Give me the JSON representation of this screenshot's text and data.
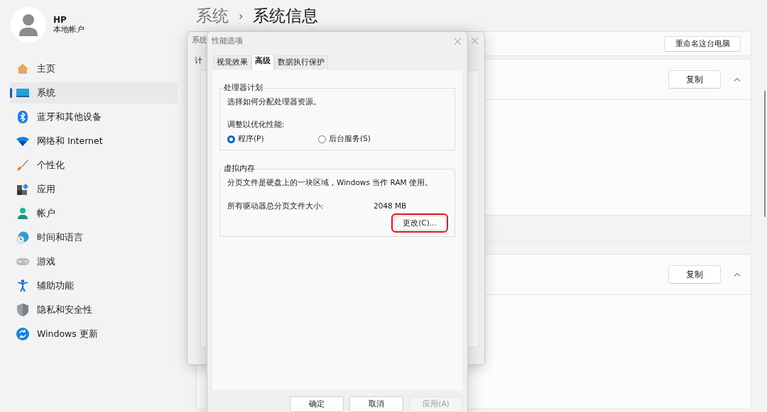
{
  "account": {
    "name": "HP",
    "type": "本地帐户"
  },
  "nav": [
    {
      "label": "主页",
      "selected": false
    },
    {
      "label": "系统",
      "selected": true
    },
    {
      "label": "蓝牙和其他设备",
      "selected": false
    },
    {
      "label": "网络和 Internet",
      "selected": false
    },
    {
      "label": "个性化",
      "selected": false
    },
    {
      "label": "应用",
      "selected": false
    },
    {
      "label": "帐户",
      "selected": false
    },
    {
      "label": "时间和语言",
      "selected": false
    },
    {
      "label": "游戏",
      "selected": false
    },
    {
      "label": "辅助功能",
      "selected": false
    },
    {
      "label": "隐私和安全性",
      "selected": false
    },
    {
      "label": "Windows 更新",
      "selected": false
    }
  ],
  "breadcrumb": {
    "parent": "系统",
    "separator": "›",
    "current": "系统信息"
  },
  "cards": [
    {
      "kind": "action",
      "button": "重命名这台电脑"
    },
    {
      "kind": "section",
      "button": "复制",
      "expanded": true
    },
    {
      "kind": "section",
      "button": "复制",
      "expanded": true
    }
  ],
  "back_dialog": {
    "title": "系统",
    "tab": "计"
  },
  "perf_dialog": {
    "title": "性能选项",
    "tabs": [
      {
        "label": "视觉效果",
        "selected": false
      },
      {
        "label": "高级",
        "selected": true
      },
      {
        "label": "数据执行保护",
        "selected": false
      }
    ],
    "processor_group": {
      "title": "处理器计划",
      "description": "选择如何分配处理器资源。",
      "prompt": "调整以优化性能:",
      "options": [
        {
          "label": "程序(P)",
          "selected": true
        },
        {
          "label": "后台服务(S)",
          "selected": false
        }
      ]
    },
    "vm_group": {
      "title": "虚拟内存",
      "description": "分页文件是硬盘上的一块区域，Windows 当作 RAM 使用。",
      "size_label": "所有驱动器总分页文件大小:",
      "size_value": "2048 MB",
      "button": {
        "label": "更改(C)...",
        "highlighted": true
      }
    },
    "buttons": [
      {
        "label": "确定",
        "disabled": false
      },
      {
        "label": "取消",
        "disabled": false
      },
      {
        "label": "应用(A)",
        "disabled": true
      }
    ]
  }
}
